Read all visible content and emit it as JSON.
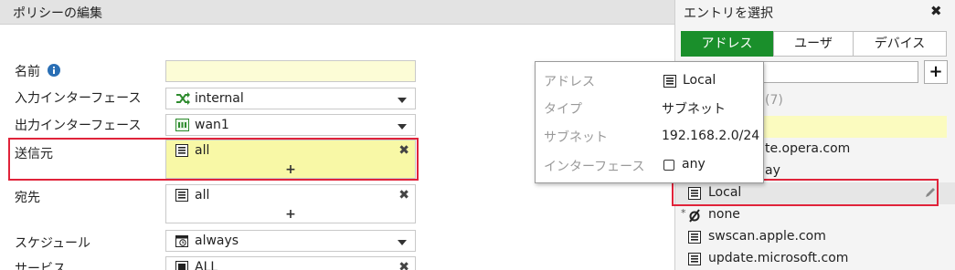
{
  "left": {
    "title": "ポリシーの編集",
    "fields": {
      "name": {
        "label": "名前",
        "value": ""
      },
      "incoming": {
        "label": "入力インターフェース",
        "value": "internal"
      },
      "outgoing": {
        "label": "出力インターフェース",
        "value": "wan1"
      },
      "source": {
        "label": "送信元",
        "value": "all",
        "add": "+"
      },
      "destination": {
        "label": "宛先",
        "value": "all",
        "add": "+"
      },
      "schedule": {
        "label": "スケジュール",
        "value": "always"
      },
      "service": {
        "label": "サービス",
        "value": "ALL"
      }
    },
    "remove_glyph": "✖"
  },
  "right": {
    "title": "エントリを選択",
    "close_glyph": "✖",
    "tabs": [
      "アドレス",
      "ユーザ",
      "デバイス"
    ],
    "active_tab": 0,
    "add_glyph": "+",
    "section_count": "(7)",
    "partial_items": [
      "te.opera.com",
      "ay"
    ],
    "items": [
      {
        "label": "Local",
        "icon": "address-icon"
      },
      {
        "label": "none",
        "icon": "none-icon",
        "mark": "*"
      },
      {
        "label": "swscan.apple.com",
        "icon": "address-icon"
      },
      {
        "label": "update.microsoft.com",
        "icon": "address-icon"
      }
    ]
  },
  "tooltip": {
    "rows": [
      {
        "label": "アドレス",
        "value": "Local"
      },
      {
        "label": "タイプ",
        "value": "サブネット"
      },
      {
        "label": "サブネット",
        "value": "192.168.2.0/24"
      },
      {
        "label": "インターフェース",
        "value": "any"
      }
    ]
  },
  "colors": {
    "accent_green": "#1a8f2b",
    "highlight_red": "#e0233a",
    "field_yellow": "#f8f8a6",
    "info_blue": "#2a6fb5"
  }
}
